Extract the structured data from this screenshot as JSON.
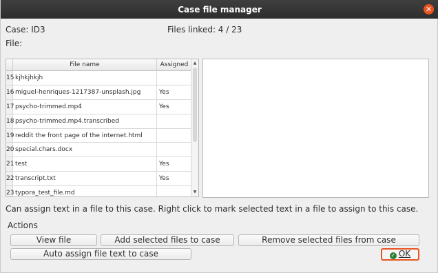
{
  "window": {
    "title": "Case file manager",
    "close_symbol": "✕"
  },
  "case": {
    "label": "Case: ID3",
    "files_linked": "Files linked: 4 / 23",
    "file_label": "File:"
  },
  "table": {
    "columns": [
      "File name",
      "Assigned"
    ],
    "rows": [
      {
        "num": "15",
        "name": "kjhkjhkjh",
        "assigned": ""
      },
      {
        "num": "16",
        "name": "miguel-henriques-1217387-unsplash.jpg",
        "assigned": "Yes"
      },
      {
        "num": "17",
        "name": "psycho-trimmed.mp4",
        "assigned": "Yes"
      },
      {
        "num": "18",
        "name": "psycho-trimmed.mp4.transcribed",
        "assigned": ""
      },
      {
        "num": "19",
        "name": "reddit the front page of the internet.html",
        "assigned": ""
      },
      {
        "num": "20",
        "name": "special.chars.docx",
        "assigned": ""
      },
      {
        "num": "21",
        "name": "test",
        "assigned": "Yes"
      },
      {
        "num": "22",
        "name": "transcript.txt",
        "assigned": "Yes"
      },
      {
        "num": "23",
        "name": "typora_test_file.md",
        "assigned": ""
      }
    ],
    "scroll_up": "▲",
    "scroll_down": "▼"
  },
  "info_text": "Can assign text in a file to this case. Right click to mark selected text in a file to assign to this case.",
  "actions": {
    "label": "Actions",
    "view_file": "View file",
    "add_selected": "Add selected files to case",
    "remove_selected": "Remove selected files from case",
    "auto_assign": "Auto assign file text to case",
    "ok": "OK",
    "ok_icon": "✓"
  },
  "colors": {
    "accent": "#e95420",
    "titlebar": "#333333",
    "ok_icon": "#2e7d32"
  }
}
